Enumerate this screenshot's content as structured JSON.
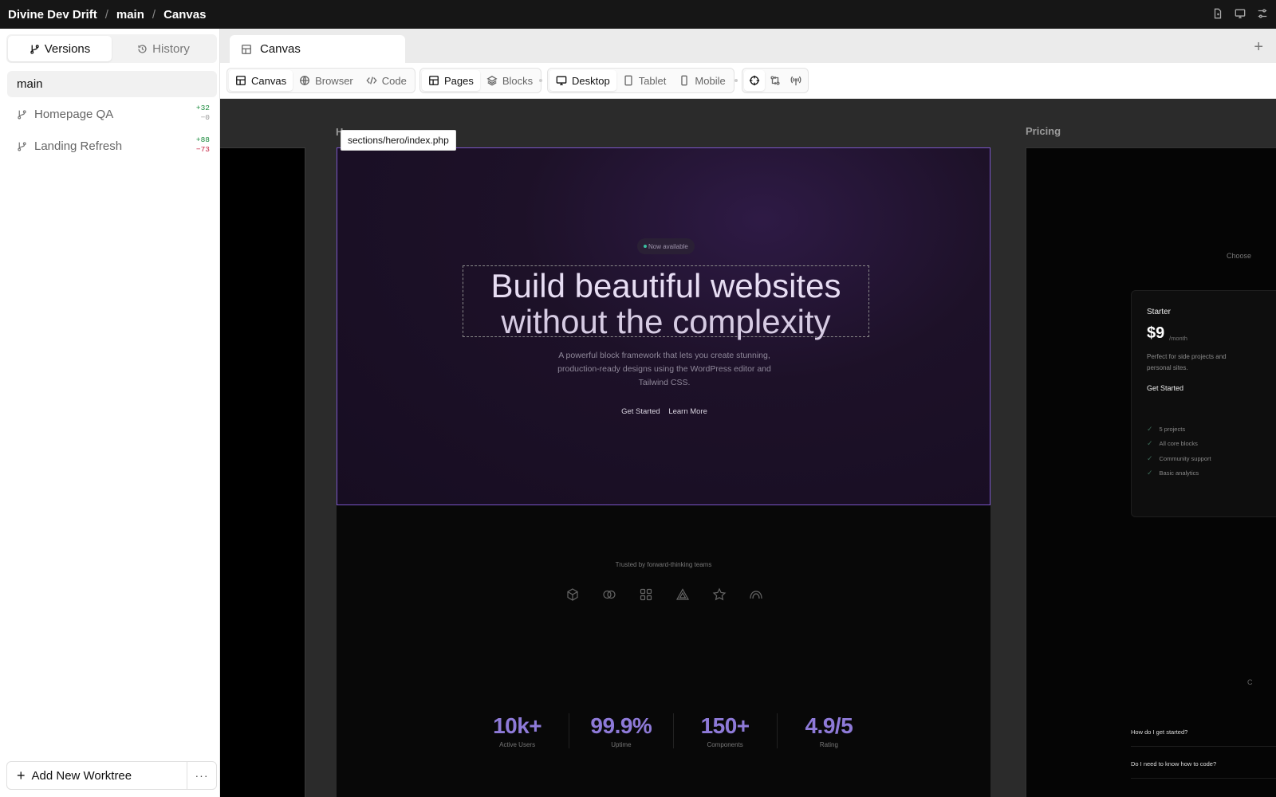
{
  "breadcrumb": [
    "Divine Dev Drift",
    "main",
    "Canvas"
  ],
  "sidebar": {
    "tabs": [
      {
        "label": "Versions",
        "active": true
      },
      {
        "label": "History",
        "active": false
      }
    ],
    "current_branch": "main",
    "worktrees": [
      {
        "name": "Homepage QA",
        "additions": "+32",
        "deletions": "−0"
      },
      {
        "name": "Landing Refresh",
        "additions": "+88",
        "deletions": "−73"
      }
    ],
    "add_worktree_label": "Add New Worktree",
    "more_label": "···"
  },
  "tabbar": {
    "active_tab": "Canvas",
    "add_label": "+"
  },
  "toolbar": {
    "views": [
      "Canvas",
      "Browser",
      "Code"
    ],
    "content": [
      "Pages",
      "Blocks"
    ],
    "devices": [
      "Desktop",
      "Tablet",
      "Mobile"
    ]
  },
  "canvas": {
    "left_frame_label": "H",
    "right_frame_label": "Pricing",
    "selected_file": "sections/hero/index.php",
    "hero": {
      "pill": "Now available",
      "headline_line1": "Build beautiful websites",
      "headline_line2": "without the complexity",
      "subtext": "A powerful block framework that lets you create stunning, production-ready designs using the WordPress editor and Tailwind CSS.",
      "cta_primary": "Get Started",
      "cta_secondary": "Learn More"
    },
    "trusted": {
      "label": "Trusted by forward-thinking teams",
      "logos": [
        "cube-logo-icon",
        "rings-logo-icon",
        "grid-logo-icon",
        "triangle-logo-icon",
        "star-logo-icon",
        "arch-logo-icon"
      ]
    },
    "stats": [
      {
        "value": "10k+",
        "label": "Active Users"
      },
      {
        "value": "99.9%",
        "label": "Uptime"
      },
      {
        "value": "150+",
        "label": "Components"
      },
      {
        "value": "4.9/5",
        "label": "Rating"
      }
    ],
    "pricing": {
      "choose_text": "Choose",
      "plan_name": "Starter",
      "price": "$9",
      "period": "/month",
      "description": "Perfect for side projects and personal sites.",
      "cta": "Get Started",
      "features": [
        "5 projects",
        "All core blocks",
        "Community support",
        "Basic analytics"
      ],
      "faqs": [
        "How do I get started?",
        "Do I need to know how to code?"
      ],
      "trailing_char": "C"
    }
  },
  "colors": {
    "accent": "#7a55c8",
    "stat_value": "#8e7ad8",
    "topbar": "#161616",
    "canvas_bg": "#2b2b2b"
  }
}
